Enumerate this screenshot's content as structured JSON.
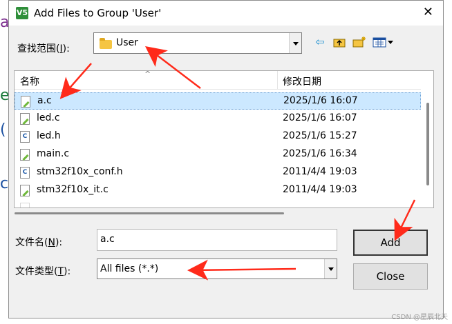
{
  "background": {
    "chars": [
      "a",
      "e",
      "(",
      "c"
    ]
  },
  "window": {
    "title": "Add Files to Group 'User'",
    "close_symbol": "✕",
    "app_icon_text": "V5"
  },
  "look_in": {
    "label": "查找范围(I):",
    "label_main": "查找范围(",
    "label_key": "I",
    "label_tail": "):",
    "value": "User"
  },
  "toolbar": {
    "back_icon": "back-arrow-icon",
    "up_icon": "folder-up-icon",
    "new_folder_icon": "new-folder-icon",
    "view_menu_icon": "view-menu-icon"
  },
  "file_list": {
    "columns": [
      "名称",
      "修改日期"
    ],
    "rows": [
      {
        "name": "a.c",
        "date": "2025/1/6 16:07",
        "icon": "edit-file-icon",
        "selected": true
      },
      {
        "name": "led.c",
        "date": "2025/1/6 16:07",
        "icon": "edit-file-icon",
        "selected": false
      },
      {
        "name": "led.h",
        "date": "2025/1/6 15:27",
        "icon": "c-file-icon",
        "selected": false
      },
      {
        "name": "main.c",
        "date": "2025/1/6 16:34",
        "icon": "edit-file-icon",
        "selected": false
      },
      {
        "name": "stm32f10x_conf.h",
        "date": "2011/4/4 19:03",
        "icon": "c-file-icon",
        "selected": false
      },
      {
        "name": "stm32f10x_it.c",
        "date": "2011/4/4 19:03",
        "icon": "edit-file-icon",
        "selected": false
      }
    ]
  },
  "file_name": {
    "label_main": "文件名(",
    "label_key": "N",
    "label_tail": "):",
    "value": "a.c"
  },
  "file_type": {
    "label_main": "文件类型(",
    "label_key": "T",
    "label_tail": "):",
    "value": "All files (*.*)"
  },
  "buttons": {
    "add": "Add",
    "close": "Close"
  },
  "watermark": "CSDN @星辰北天",
  "colors": {
    "selection": "#cce8ff",
    "annotation_arrow": "#ff2a1a",
    "folder": "#f5c542"
  }
}
